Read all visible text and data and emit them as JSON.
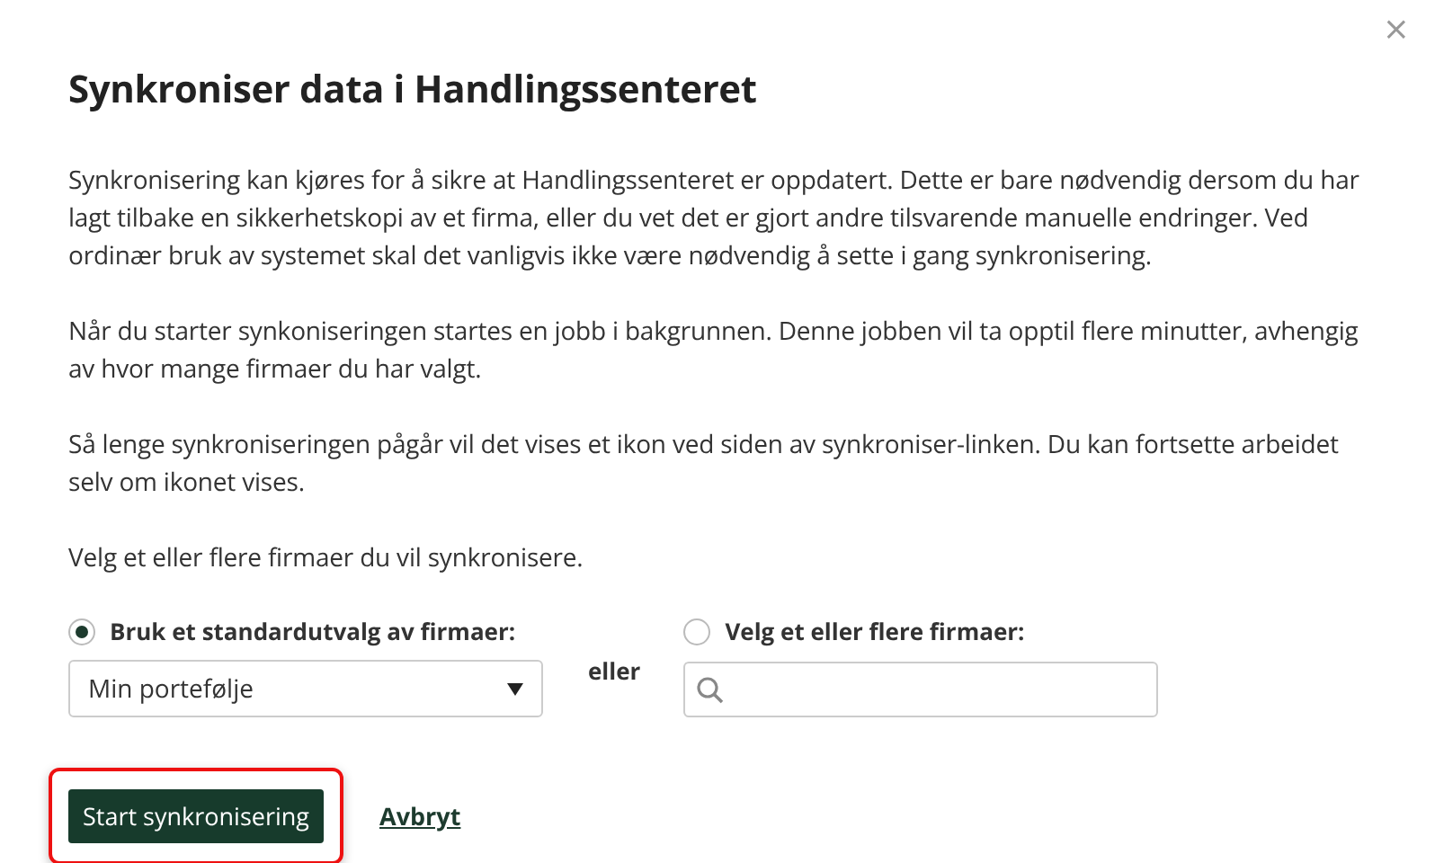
{
  "close_button": "×",
  "title": "Synkroniser data i Handlingssenteret",
  "paragraphs": [
    "Synkronisering kan kjøres for å sikre at Handlingssenteret er oppdatert. Dette er bare nødvendig dersom du har lagt tilbake en sikkerhetskopi av et firma, eller du vet det er gjort andre tilsvarende manuelle endringer. Ved ordinær bruk av systemet skal det vanligvis ikke være nødvendig å sette i gang synkronisering.",
    "Når du starter synkoniseringen startes en jobb i bakgrunnen. Denne jobben vil ta opptil flere minutter, avhengig av hvor mange firmaer du har valgt.",
    "Så lenge synkroniseringen pågår vil det vises et ikon ved siden av synkroniser-linken. Du kan fortsette arbeidet selv om ikonet vises.",
    "Velg et eller flere firmaer du vil synkronisere."
  ],
  "options": [
    {
      "kind": "dropdown",
      "label": "Bruk et standardutvalg av firmaer:",
      "selected": true,
      "value": "Min portefølje"
    },
    {
      "kind": "search",
      "label": "Velg et eller flere firmaer:",
      "selected": false
    }
  ],
  "separator": "eller",
  "start_button": {
    "label": "Start synkronisering",
    "highlighted": true
  },
  "cancel_link": "Avbryt"
}
